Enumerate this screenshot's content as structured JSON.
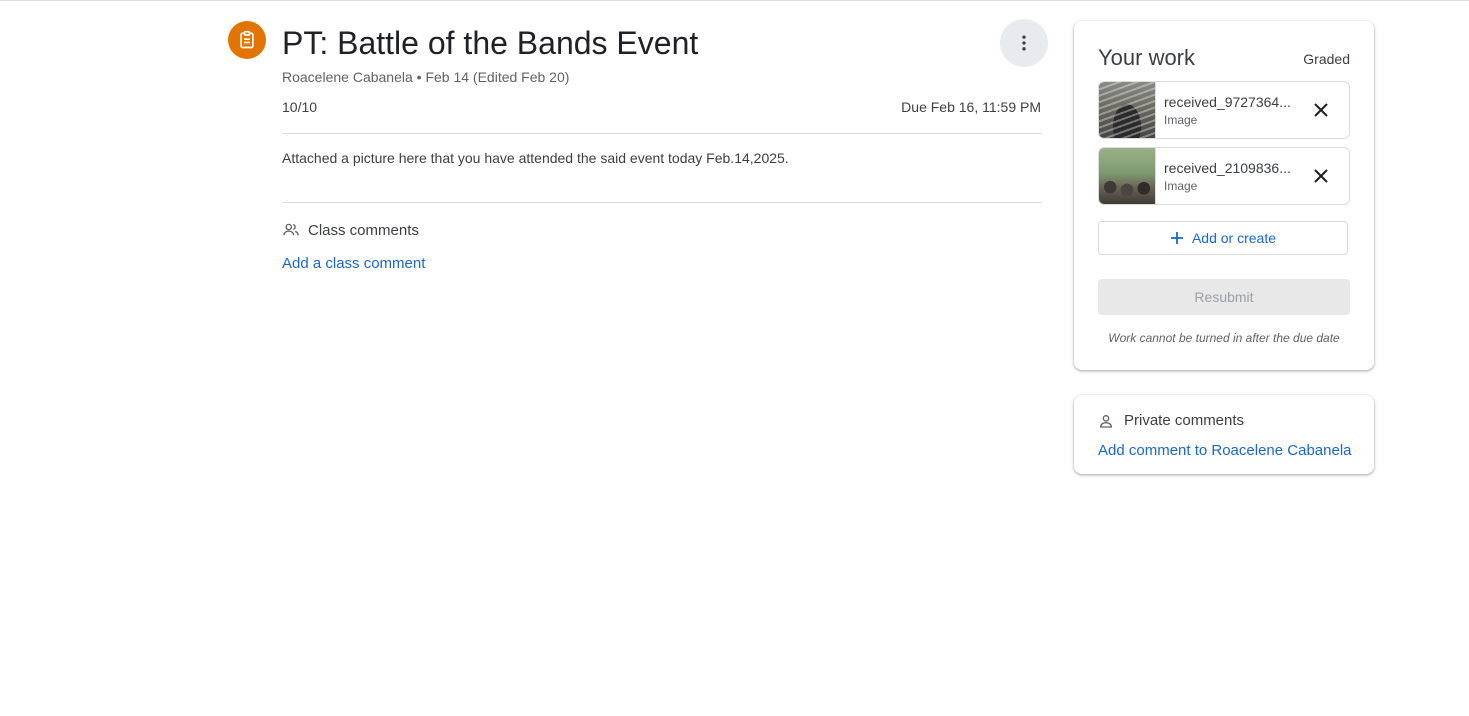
{
  "assignment": {
    "icon": "assignment-icon",
    "title": "PT: Battle of the Bands Event",
    "meta": "Roacelene Cabanela • Feb 14 (Edited Feb 20)",
    "points": "10/10",
    "due": "Due Feb 16, 11:59 PM",
    "instructions": "Attached a picture here that you have attended the said event today Feb.14,2025.",
    "accent_color": "#e37400"
  },
  "class_comments": {
    "icon": "people-icon",
    "label": "Class comments",
    "add_link": "Add a class comment"
  },
  "your_work": {
    "title": "Your work",
    "status": "Graded",
    "attachments": [
      {
        "name": "received_9727364...",
        "type": "Image"
      },
      {
        "name": "received_2109836...",
        "type": "Image"
      }
    ],
    "add_label": "Add or create",
    "resubmit_label": "Resubmit",
    "note": "Work cannot be turned in after the due date"
  },
  "private_comments": {
    "icon": "person-icon",
    "label": "Private comments",
    "add_link": "Add comment to Roacelene Cabanela"
  },
  "link_color": "#1967d2"
}
